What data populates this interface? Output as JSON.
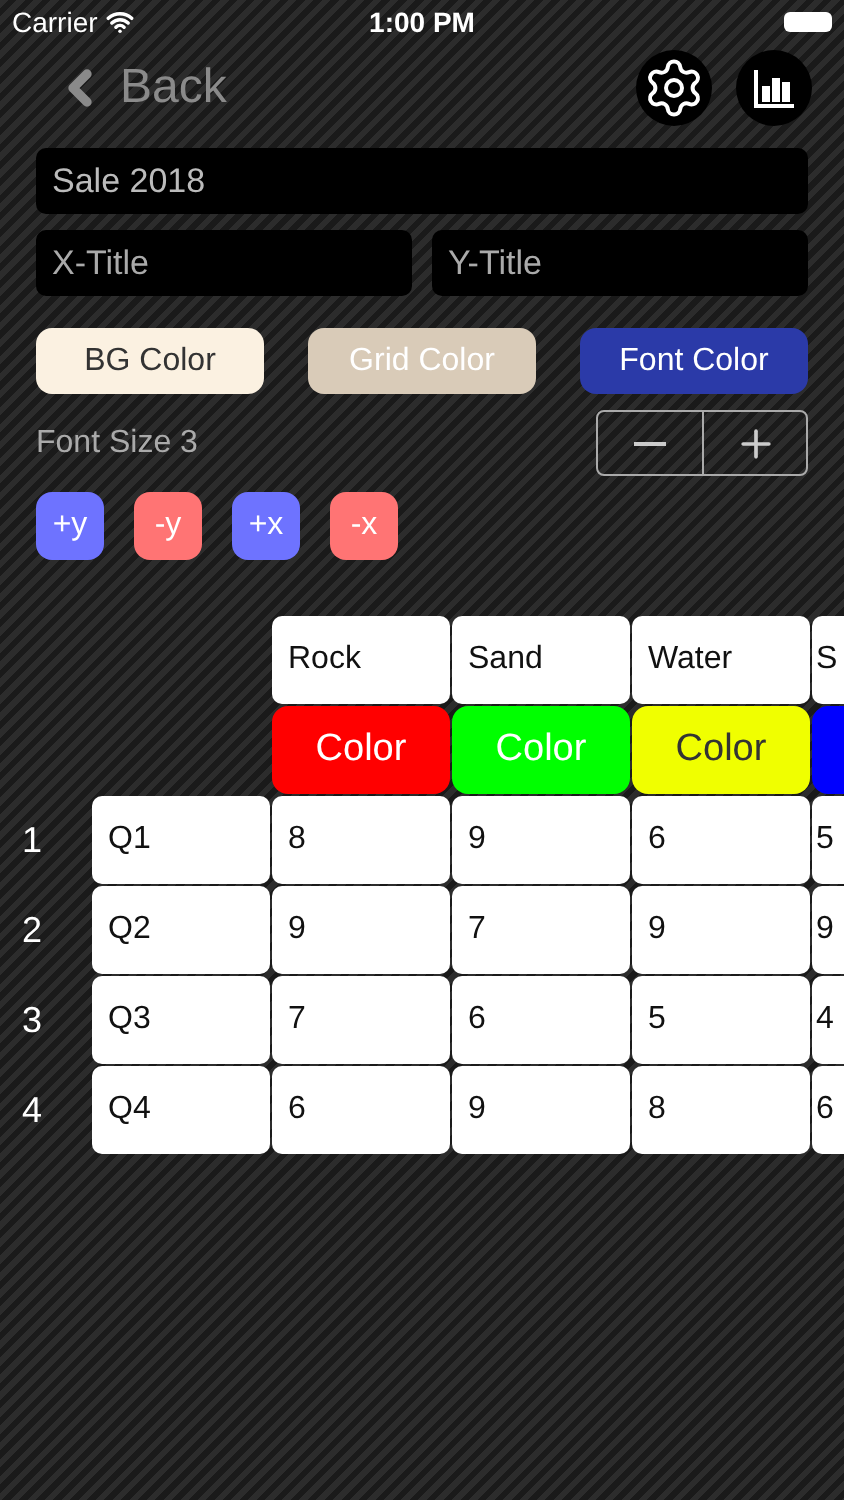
{
  "status_bar": {
    "carrier": "Carrier",
    "time": "1:00 PM"
  },
  "nav": {
    "back": "Back"
  },
  "title_field": {
    "value": "Sale 2018"
  },
  "axis_fields": [
    {
      "placeholder": "X-Title"
    },
    {
      "placeholder": "Y-Title"
    }
  ],
  "color_buttons": [
    {
      "label": "BG Color",
      "color": "#fbf1e1"
    },
    {
      "label": "Grid Color",
      "color": "#d9cbb8"
    },
    {
      "label": "Font Color",
      "color": "#2b3aa8"
    }
  ],
  "font_size": {
    "label": "Font Size 3"
  },
  "axis_buttons": [
    {
      "label": "+y",
      "kind": "add"
    },
    {
      "label": "-y",
      "kind": "remove"
    },
    {
      "label": "+x",
      "kind": "add"
    },
    {
      "label": "-x",
      "kind": "remove"
    }
  ],
  "table": {
    "columns": [
      {
        "name": "Rock",
        "color": "#ff0000",
        "color_label": "Color"
      },
      {
        "name": "Sand",
        "color": "#00ff00",
        "color_label": "Color"
      },
      {
        "name": "Water",
        "color": "#f0ff00",
        "color_label": "Color"
      },
      {
        "name": "S",
        "color": "#0000ff"
      }
    ],
    "rows": [
      {
        "number": "1",
        "label": "Q1",
        "values": [
          "8",
          "9",
          "6",
          "5"
        ]
      },
      {
        "number": "2",
        "label": "Q2",
        "values": [
          "9",
          "7",
          "9",
          "9"
        ]
      },
      {
        "number": "3",
        "label": "Q3",
        "values": [
          "7",
          "6",
          "5",
          "4"
        ]
      },
      {
        "number": "4",
        "label": "Q4",
        "values": [
          "6",
          "9",
          "8",
          "6"
        ]
      }
    ]
  }
}
